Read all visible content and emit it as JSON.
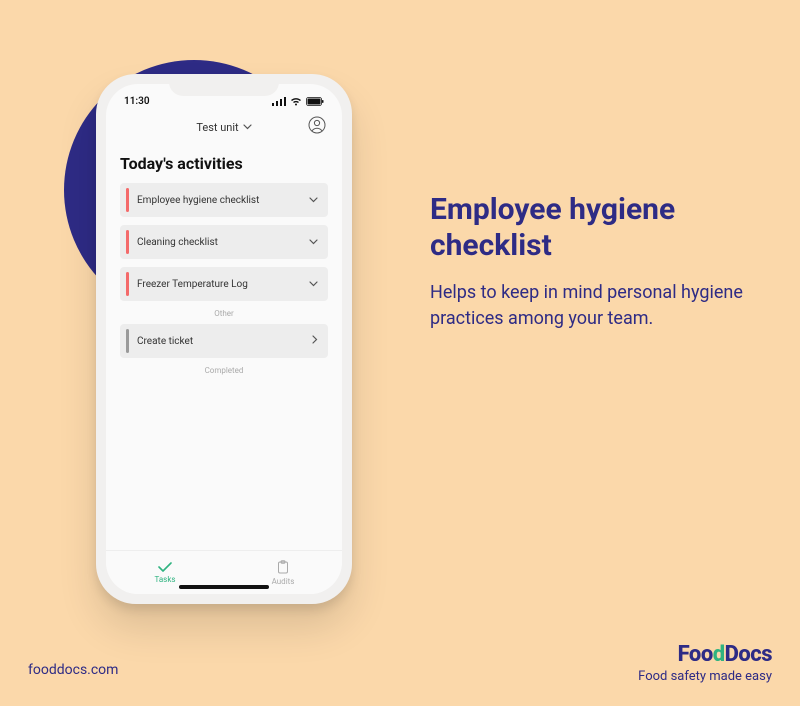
{
  "phone": {
    "time": "11:30",
    "unit_label": "Test unit",
    "heading": "Today's activities",
    "activities": [
      {
        "label": "Employee hygiene checklist",
        "chevron": "down",
        "stripe": "red"
      },
      {
        "label": "Cleaning checklist",
        "chevron": "down",
        "stripe": "red"
      },
      {
        "label": "Freezer Temperature Log",
        "chevron": "down",
        "stripe": "red"
      }
    ],
    "section_other": "Other",
    "other_item": {
      "label": "Create ticket",
      "chevron": "right",
      "stripe": "gray"
    },
    "section_completed": "Completed",
    "tabs": {
      "tasks": "Tasks",
      "audits": "Audits"
    }
  },
  "headline": {
    "title": "Employee hygiene checklist",
    "subtitle": "Helps to keep in mind personal hygiene practices among your team."
  },
  "footer": {
    "url": "fooddocs.com",
    "brand1": "Foo",
    "brand2": "d",
    "brand3": "Docs",
    "tagline": "Food safety made easy"
  }
}
